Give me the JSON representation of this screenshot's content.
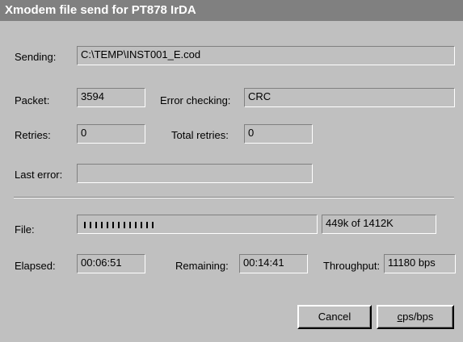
{
  "title": "Xmodem file send for PT878 IrDA",
  "sending": {
    "label": "Sending:",
    "value": "C:\\TEMP\\INST001_E.cod"
  },
  "packet": {
    "label": "Packet:",
    "value": "3594"
  },
  "error_checking": {
    "label": "Error checking:",
    "value": "CRC"
  },
  "retries": {
    "label": "Retries:",
    "value": "0"
  },
  "total_retries": {
    "label": "Total retries:",
    "value": "0"
  },
  "last_error": {
    "label": "Last error:",
    "value": ""
  },
  "file": {
    "label": "File:",
    "progress_fraction": 0.32,
    "size_text": "449k of 1412K"
  },
  "elapsed": {
    "label": "Elapsed:",
    "value": "00:06:51"
  },
  "remaining": {
    "label": "Remaining:",
    "value": "00:14:41"
  },
  "throughput": {
    "label": "Throughput:",
    "value": "11180 bps"
  },
  "buttons": {
    "cancel": "Cancel",
    "cps_first": "c",
    "cps_rest": "ps/bps"
  },
  "colors": {
    "titlebar": "#808080",
    "face": "#c0c0c0",
    "progress_block": "#000000"
  }
}
